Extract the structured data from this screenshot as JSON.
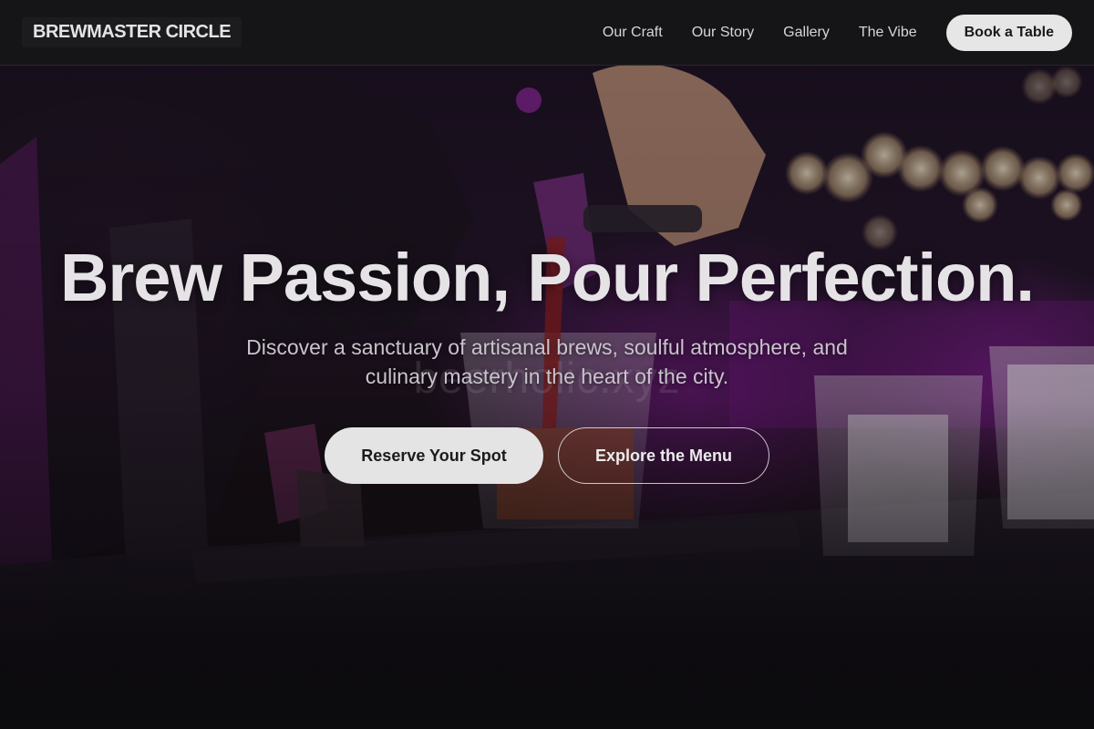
{
  "nav": {
    "brand": "BREWMASTER CIRCLE",
    "links": [
      {
        "label": "Our Craft"
      },
      {
        "label": "Our Story"
      },
      {
        "label": "Gallery"
      },
      {
        "label": "The Vibe"
      }
    ],
    "cta": "Book a Table"
  },
  "hero": {
    "headline": "Brew Passion, Pour Perfection.",
    "subtext": "Discover a sanctuary of artisanal brews, soulful atmosphere, and culinary mastery in the heart of the city.",
    "watermark": "beerholic.xyz",
    "primary_button": "Reserve Your Spot",
    "secondary_button": "Explore the Menu"
  },
  "colors": {
    "background": "#0d0c0f",
    "accent_purple": "#9a1fb0",
    "button_light": "#e4e4e4",
    "text_light": "#e6e3e6"
  }
}
